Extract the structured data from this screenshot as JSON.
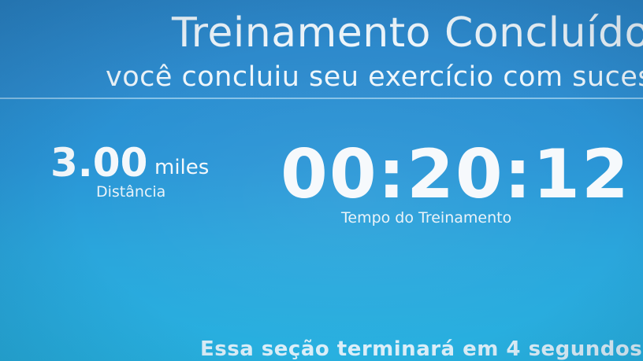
{
  "header": {
    "title": "Treinamento Concluído",
    "subtitle": "você concluiu seu exercício com sucesso"
  },
  "stats": {
    "distance": {
      "value": "3.00",
      "unit": "miles",
      "label": "Distância"
    },
    "time": {
      "value": "00:20:12",
      "label": "Tempo do Treinamento"
    }
  },
  "footer": {
    "message": "Essa seção terminará em 4 segundos."
  },
  "colors": {
    "background": "#2b95d6",
    "text": "#f2f8fc"
  }
}
